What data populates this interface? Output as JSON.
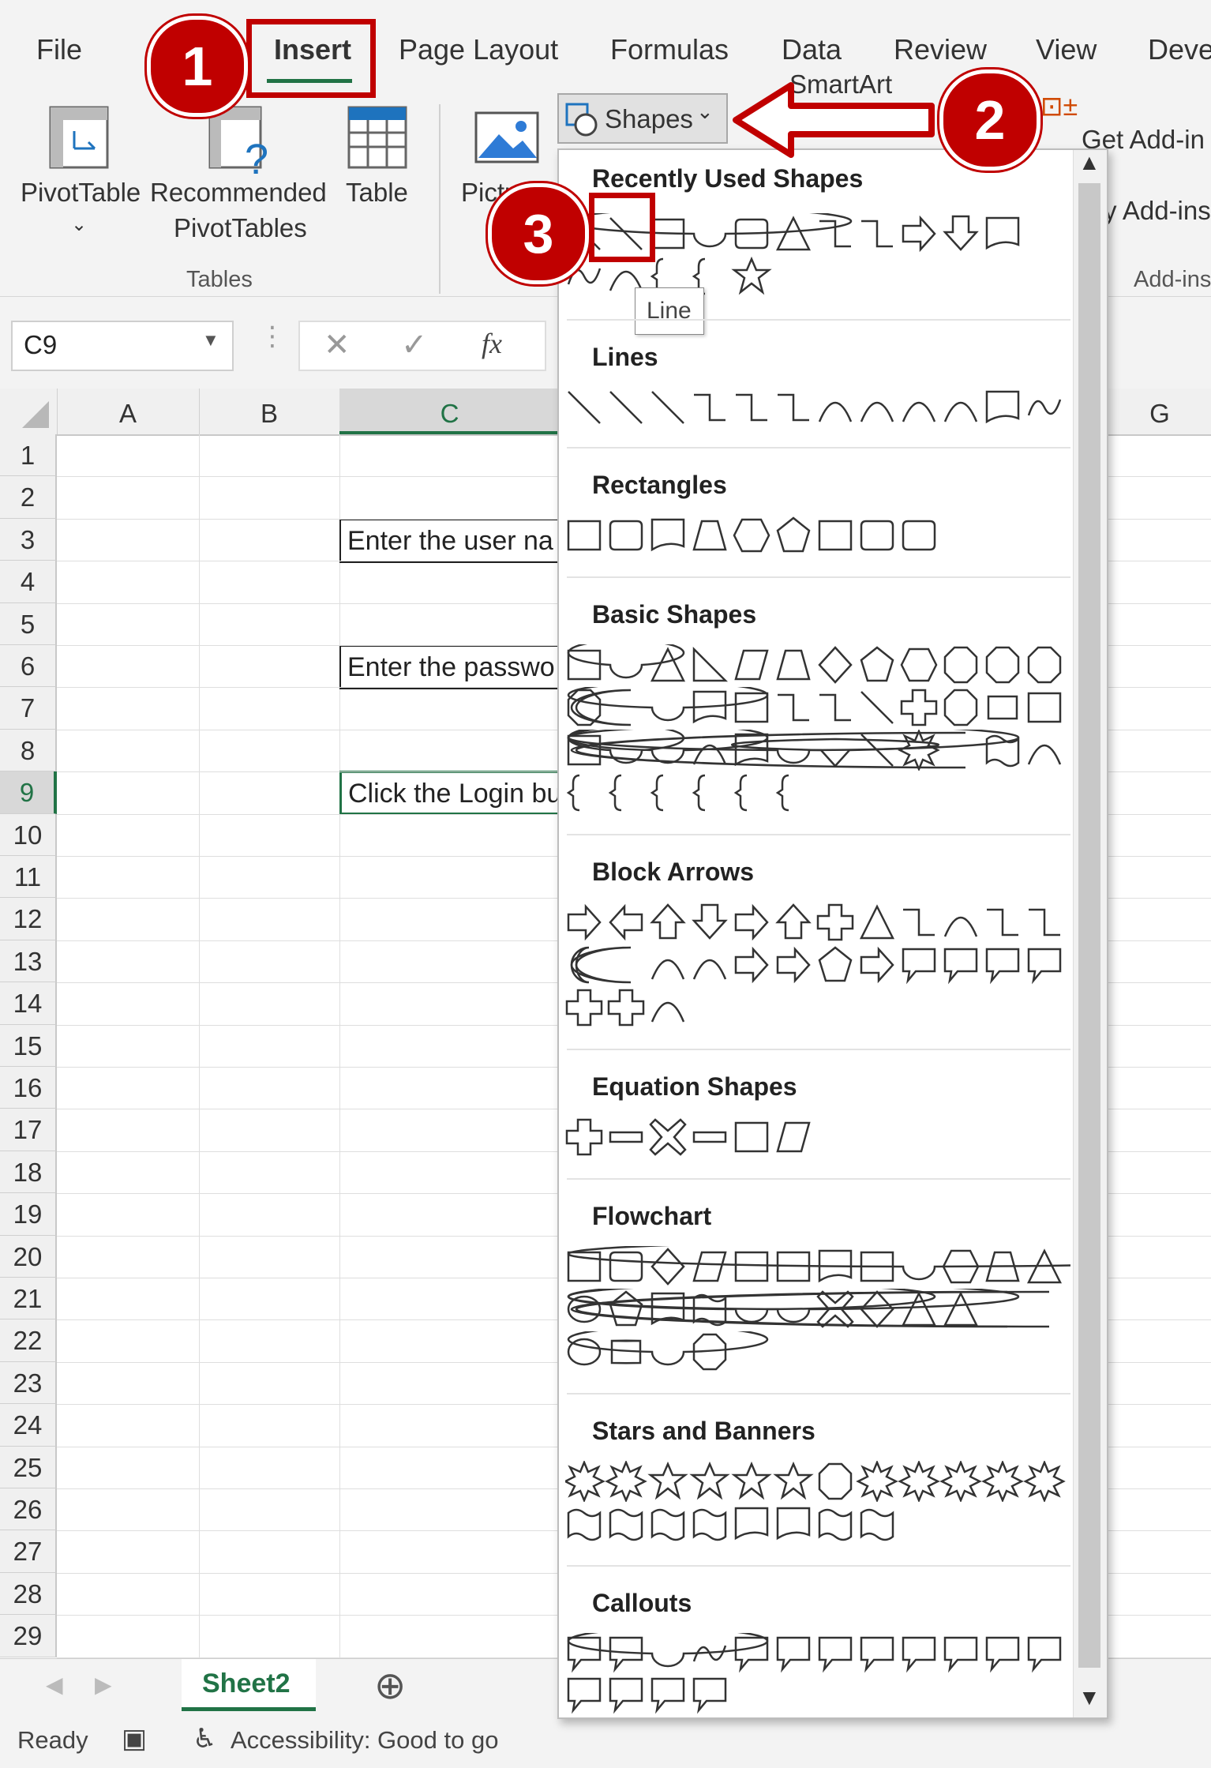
{
  "tabs": [
    "File",
    "Insert",
    "Page Layout",
    "Formulas",
    "Data",
    "Review",
    "View",
    "Deve"
  ],
  "ribbon": {
    "pivottable": "PivotTable",
    "recommended_line1": "Recommended",
    "recommended_line2": "PivotTables",
    "table": "Table",
    "pictures": "Pictu",
    "shapes": "Shapes",
    "smartart": "SmartArt",
    "get_addins": "Get Add-in",
    "my_addins": "y Add-ins",
    "tables_group": "Tables",
    "addins_group": "Add-ins"
  },
  "formula_bar": {
    "name_box": "C9",
    "fx": "fx"
  },
  "columns": [
    "A",
    "B",
    "C",
    "G"
  ],
  "rows": [
    "1",
    "2",
    "3",
    "4",
    "5",
    "6",
    "7",
    "8",
    "9",
    "10",
    "11",
    "12",
    "13",
    "14",
    "15",
    "16",
    "17",
    "18",
    "19",
    "20",
    "21",
    "22",
    "23",
    "24",
    "25",
    "26",
    "27",
    "28",
    "29"
  ],
  "cells": {
    "c3": "Enter the user na",
    "c6": "Enter the passwo",
    "c9": "Click the Login bu"
  },
  "sheet_tab": "Sheet2",
  "status": {
    "ready": "Ready",
    "accessibility": "Accessibility: Good to go"
  },
  "dropdown": {
    "tooltip": "Line",
    "sections": [
      "Recently Used Shapes",
      "Lines",
      "Rectangles",
      "Basic Shapes",
      "Block Arrows",
      "Equation Shapes",
      "Flowchart",
      "Stars and Banners",
      "Callouts"
    ]
  },
  "callouts": [
    "1",
    "2",
    "3"
  ],
  "colors": {
    "accent": "#c00000",
    "excel_green": "#217346"
  }
}
